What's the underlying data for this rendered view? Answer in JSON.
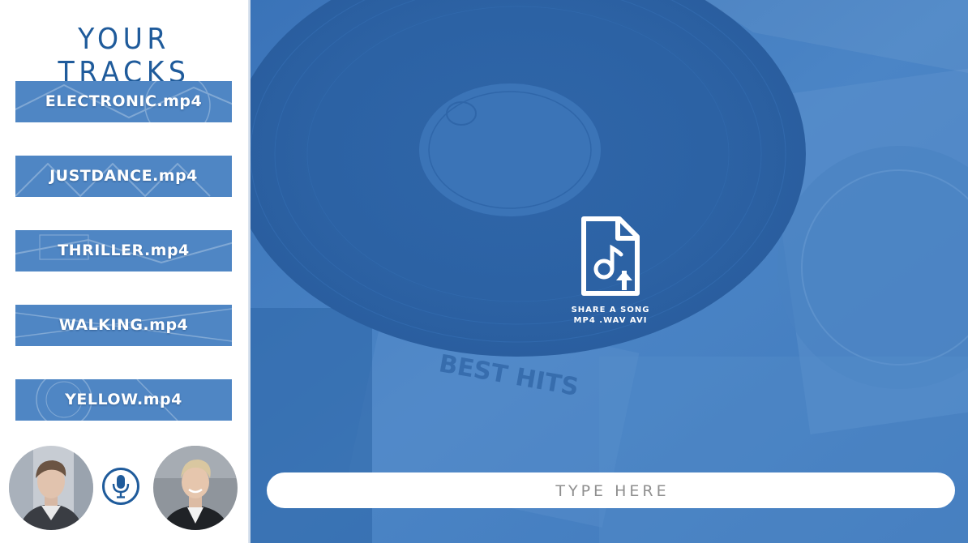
{
  "sidebar": {
    "title": "YOUR TRACKS",
    "tracks": [
      {
        "label": "ELECTRONIC.mp4"
      },
      {
        "label": "JUSTDANCE.mp4"
      },
      {
        "label": "THRILLER.mp4"
      },
      {
        "label": "WALKING.mp4"
      },
      {
        "label": "YELLOW.mp4"
      }
    ],
    "mic_icon": "microphone-icon"
  },
  "upload": {
    "icon": "music-file-upload-icon",
    "title": "SHARE A SONG",
    "formats": "MP4 .WAV AVI"
  },
  "input": {
    "placeholder": "TYPE HERE",
    "value": ""
  },
  "colors": {
    "brand_blue": "#1f5b9b",
    "track_blue": "#4f86c4",
    "main_blue": "#3f7ac0",
    "white": "#ffffff",
    "placeholder_gray": "#8f8f8f"
  }
}
